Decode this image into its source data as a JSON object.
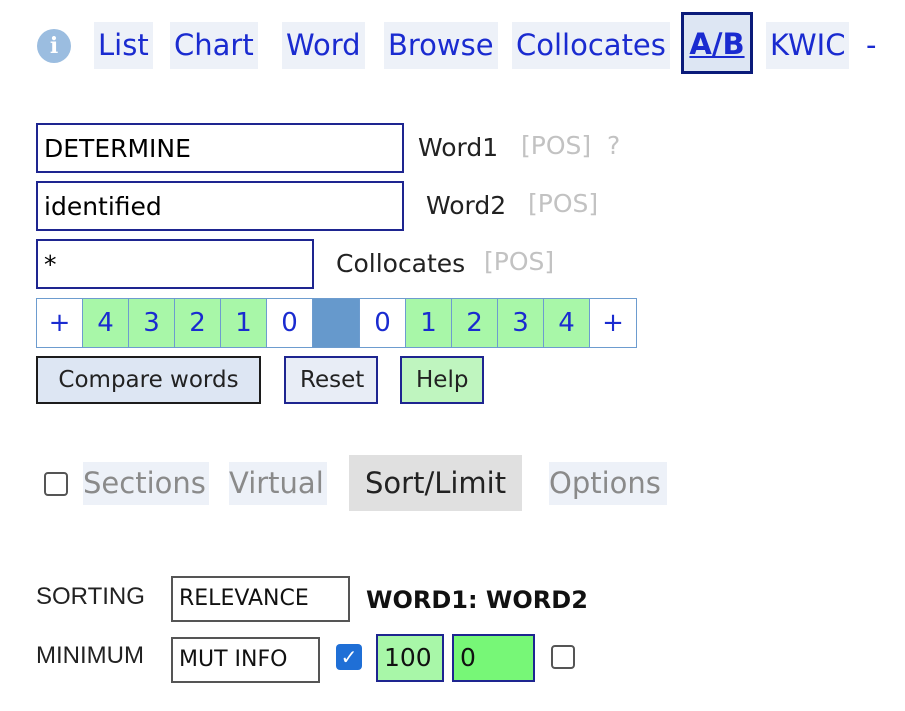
{
  "nav": {
    "info_icon": "info-icon",
    "items": [
      "List",
      "Chart",
      "Word",
      "Browse",
      "Collocates",
      "A/B",
      "KWIC"
    ],
    "active": "A/B",
    "trailing": "-"
  },
  "form": {
    "word1": {
      "value": "DETERMINE",
      "label": "Word1",
      "pos": "[POS]",
      "help": "?"
    },
    "word2": {
      "value": "identified",
      "label": "Word2",
      "pos": "[POS]"
    },
    "collocates": {
      "value": "*",
      "label": "Collocates",
      "pos": "[POS]"
    }
  },
  "span": {
    "left": [
      "+",
      "4",
      "3",
      "2",
      "1",
      "0"
    ],
    "right": [
      "0",
      "1",
      "2",
      "3",
      "4",
      "+"
    ]
  },
  "buttons": {
    "compare": "Compare words",
    "reset": "Reset",
    "help": "Help"
  },
  "tabs": {
    "sections": "Sections",
    "virtual": "Virtual",
    "sort_limit": "Sort/Limit",
    "options": "Options",
    "active": "Sort/Limit"
  },
  "sorting": {
    "sorting_label": "SORTING",
    "sorting_value": "RELEVANCE",
    "heading": "WORD1: WORD2",
    "minimum_label": "MINIMUM",
    "minimum_value": "MUT INFO",
    "min_freq": "100",
    "min_value": "0"
  },
  "colors": {
    "link": "#1a2bd0",
    "green_cell": "#a8f7a8",
    "node_cell": "#6699cc",
    "bright_green": "#77f777",
    "check_blue": "#1f6fd6"
  }
}
